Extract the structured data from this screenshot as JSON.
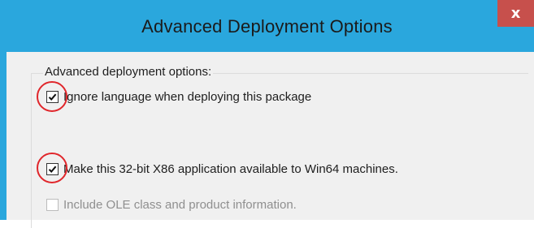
{
  "dialog": {
    "title": "Advanced Deployment Options",
    "close_glyph": "x"
  },
  "group": {
    "legend": "Advanced deployment options:"
  },
  "options": [
    {
      "label": "Ignore language when deploying this package",
      "checked": true,
      "enabled": true,
      "highlighted": true
    },
    {
      "label": "Make this 32-bit X86 application available to Win64 machines.",
      "checked": true,
      "enabled": true,
      "highlighted": true
    },
    {
      "label": "Include OLE class and product information.",
      "checked": false,
      "enabled": false,
      "highlighted": false
    }
  ],
  "colors": {
    "titlebar": "#2aa7dd",
    "close_button": "#c7504c",
    "highlight_ring": "#e0262b",
    "client_background": "#f0f0f0"
  }
}
